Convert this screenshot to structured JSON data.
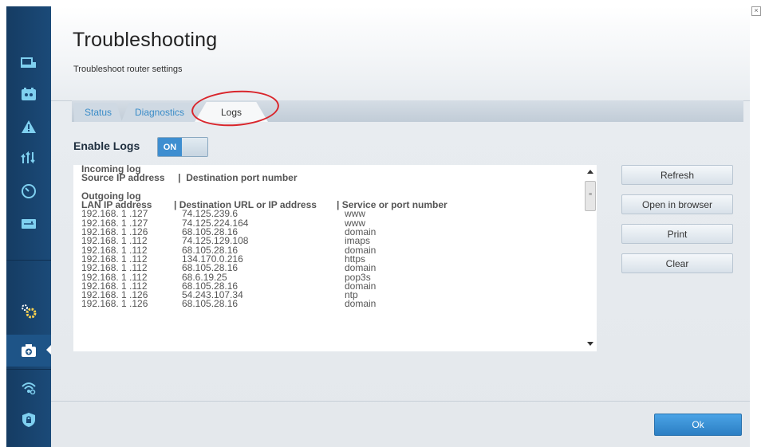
{
  "header": {
    "title": "Troubleshooting",
    "subtitle": "Troubleshoot router settings"
  },
  "tabs": [
    {
      "label": "Status",
      "active": false
    },
    {
      "label": "Diagnostics",
      "active": false
    },
    {
      "label": "Logs",
      "active": true
    }
  ],
  "enable_logs": {
    "label": "Enable Logs",
    "toggle_state": "ON"
  },
  "log": {
    "incoming_title": "Incoming log",
    "incoming_header": "Source IP address     |  Destination port number",
    "outgoing_title": "Outgoing log",
    "outgoing_columns": [
      "LAN IP address",
      "|  Destination URL or IP address",
      "|  Service or port number"
    ],
    "rows": [
      [
        "192.168. 1 .127",
        "74.125.239.6",
        "www"
      ],
      [
        "192.168. 1 .127",
        "74.125.224.164",
        "www"
      ],
      [
        "192.168. 1 .126",
        "68.105.28.16",
        "domain"
      ],
      [
        "192.168. 1 .112",
        "74.125.129.108",
        "imaps"
      ],
      [
        "192.168. 1 .112",
        "68.105.28.16",
        "domain"
      ],
      [
        "192.168. 1 .112",
        "134.170.0.216",
        "https"
      ],
      [
        "192.168. 1 .112",
        "68.105.28.16",
        "domain"
      ],
      [
        "192.168. 1 .112",
        "68.6.19.25",
        "pop3s"
      ],
      [
        "192.168. 1 .112",
        "68.105.28.16",
        "domain"
      ],
      [
        "192.168. 1 .126",
        "54.243.107.34",
        "ntp"
      ],
      [
        "192.168. 1 .126",
        "68.105.28.16",
        "domain"
      ]
    ]
  },
  "buttons": {
    "refresh": "Refresh",
    "open_in_browser": "Open in browser",
    "print": "Print",
    "clear": "Clear",
    "ok": "Ok"
  },
  "close_glyph": "×",
  "scrollbar_grip": "≡",
  "colors": {
    "sidebar": "#153c63",
    "accent": "#3e8ed0",
    "tab_text": "#3a8cc8",
    "highlight": "#d9252b"
  },
  "sidebar_icons": [
    "devices-icon",
    "parental-controls-icon",
    "warning-icon",
    "media-prioritization-icon",
    "speed-test-icon",
    "usb-icon",
    "settings-gears-icon",
    "troubleshooting-camera-icon",
    "wireless-icon",
    "security-shield-icon"
  ]
}
